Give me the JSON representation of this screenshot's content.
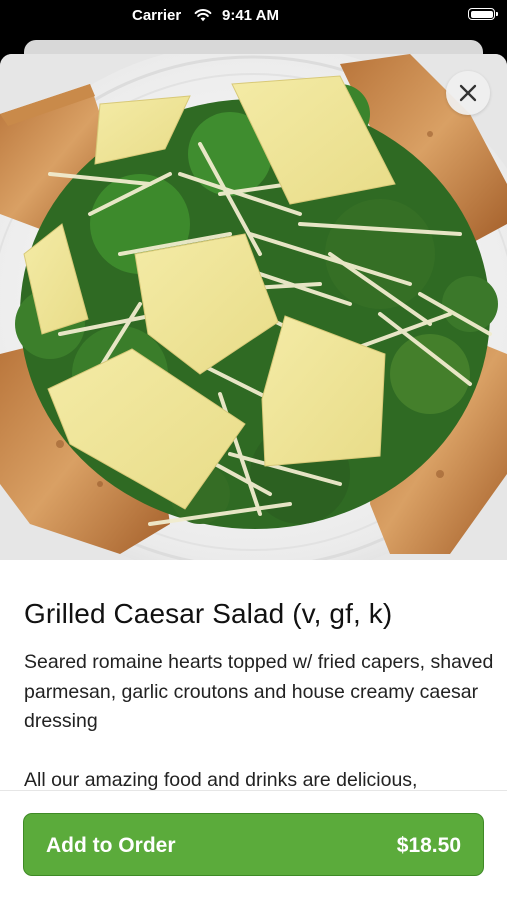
{
  "status_bar": {
    "carrier": "Carrier",
    "time": "9:41 AM"
  },
  "item": {
    "image_alt": "Grilled Caesar Salad with shaved parmesan and garlic croutons",
    "title": "Grilled Caesar Salad (v, gf, k)",
    "description": "Seared romaine hearts topped w/ fried capers, shaved parmesan, garlic croutons and house creamy caesar dressing",
    "note": "All our amazing food and drinks are delicious,"
  },
  "footer": {
    "add_label": "Add to Order",
    "price": "$18.50"
  },
  "icons": {
    "close": "close-icon",
    "wifi": "wifi-icon",
    "battery": "battery-icon"
  },
  "colors": {
    "button_green": "#5bab3b",
    "button_border": "#3f8a26"
  }
}
